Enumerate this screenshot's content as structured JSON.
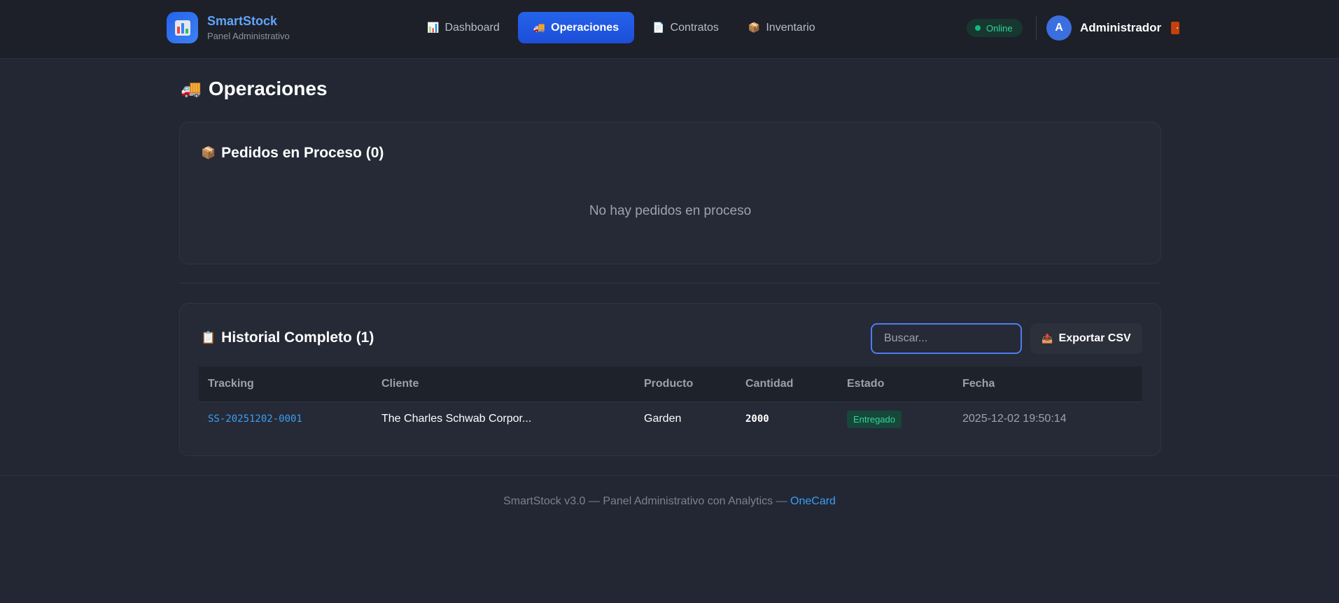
{
  "brand": {
    "title": "SmartStock",
    "subtitle": "Panel Administrativo",
    "logo_icon": "bar-chart-icon"
  },
  "nav": {
    "items": [
      {
        "label": "Dashboard",
        "icon": "📊",
        "active": false
      },
      {
        "label": "Operaciones",
        "icon": "🚚",
        "active": true
      },
      {
        "label": "Contratos",
        "icon": "📄",
        "active": false
      },
      {
        "label": "Inventario",
        "icon": "📦",
        "active": false
      }
    ]
  },
  "status": {
    "label": "Online",
    "color": "#34d399"
  },
  "user": {
    "initial": "A",
    "name": "Administrador",
    "logout_icon": "door-icon"
  },
  "page": {
    "title": "Operaciones",
    "icon": "🚚"
  },
  "pending": {
    "title": "Pedidos en Proceso (0)",
    "icon": "📦",
    "empty_message": "No hay pedidos en proceso"
  },
  "history": {
    "title": "Historial Completo (1)",
    "icon": "📋",
    "search_placeholder": "Buscar...",
    "export_label": "Exportar CSV",
    "export_icon": "📤",
    "columns": [
      "Tracking",
      "Cliente",
      "Producto",
      "Cantidad",
      "Estado",
      "Fecha"
    ],
    "rows": [
      {
        "tracking": "SS-20251202-0001",
        "cliente": "The Charles Schwab Corpor...",
        "producto": "Garden",
        "cantidad": "2000",
        "estado": "Entregado",
        "fecha": "2025-12-02 19:50:14"
      }
    ]
  },
  "footer": {
    "text": "SmartStock v3.0 — Panel Administrativo con Analytics — ",
    "link": "OneCard"
  },
  "colors": {
    "accent": "#2563eb",
    "link": "#3b9ef5",
    "success": "#34d399"
  }
}
